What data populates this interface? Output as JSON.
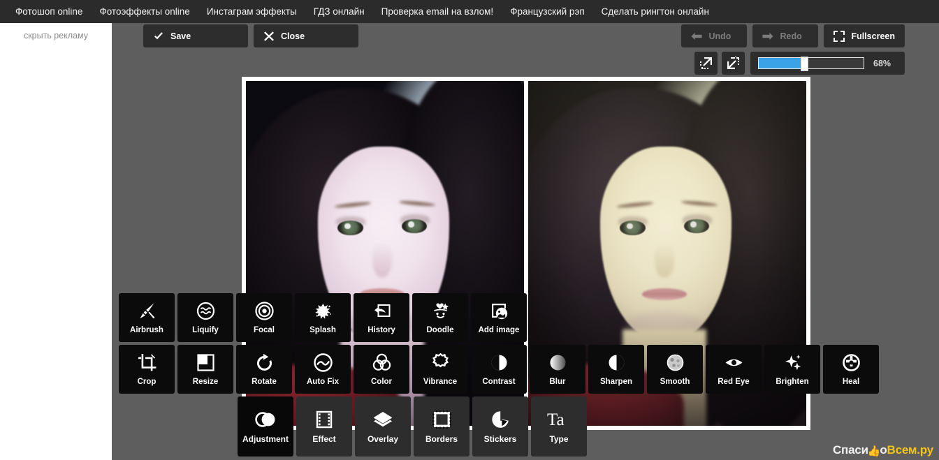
{
  "topnav": {
    "links": [
      {
        "label": "Фотошоп online"
      },
      {
        "label": "Фотоэффекты online"
      },
      {
        "label": "Инстаграм эффекты"
      },
      {
        "label": "ГДЗ онлайн"
      },
      {
        "label": "Проверка email на взлом!"
      },
      {
        "label": "Французский рэп"
      },
      {
        "label": "Сделать рингтон онлайн"
      }
    ]
  },
  "sidebar": {
    "hide_ads_label": "скрыть рекламу"
  },
  "toolbar": {
    "save_label": "Save",
    "close_label": "Close",
    "undo_label": "Undo",
    "redo_label": "Redo",
    "fullscreen_label": "Fullscreen"
  },
  "zoom": {
    "percent_label": "68%",
    "percent_value": 68,
    "fit_in_label": "zoom-out-icon",
    "fit_out_label": "zoom-in-icon",
    "fill_color": "#3aa3e8"
  },
  "tools": {
    "row_top": [
      {
        "label": "Airbrush",
        "icon": "airbrush-icon"
      },
      {
        "label": "Liquify",
        "icon": "liquify-icon"
      },
      {
        "label": "Focal",
        "icon": "focal-icon"
      },
      {
        "label": "Splash",
        "icon": "splash-icon"
      },
      {
        "label": "History",
        "icon": "history-icon"
      },
      {
        "label": "Doodle",
        "icon": "doodle-icon"
      },
      {
        "label": "Add image",
        "icon": "add-image-icon"
      }
    ],
    "row_mid": [
      {
        "label": "Crop",
        "icon": "crop-icon"
      },
      {
        "label": "Resize",
        "icon": "resize-icon"
      },
      {
        "label": "Rotate",
        "icon": "rotate-icon"
      },
      {
        "label": "Auto Fix",
        "icon": "auto-fix-icon"
      },
      {
        "label": "Color",
        "icon": "color-icon"
      },
      {
        "label": "Vibrance",
        "icon": "vibrance-icon"
      },
      {
        "label": "Contrast",
        "icon": "contrast-icon"
      },
      {
        "label": "Blur",
        "icon": "blur-icon"
      },
      {
        "label": "Sharpen",
        "icon": "sharpen-icon"
      },
      {
        "label": "Smooth",
        "icon": "smooth-icon"
      },
      {
        "label": "Red Eye",
        "icon": "red-eye-icon"
      },
      {
        "label": "Brighten",
        "icon": "brighten-icon"
      },
      {
        "label": "Heal",
        "icon": "heal-icon"
      }
    ],
    "row_bottom": [
      {
        "label": "Adjustment",
        "icon": "adjustment-icon",
        "active": true
      },
      {
        "label": "Effect",
        "icon": "effect-icon",
        "active": false
      },
      {
        "label": "Overlay",
        "icon": "overlay-icon",
        "active": false
      },
      {
        "label": "Borders",
        "icon": "borders-icon",
        "active": false
      },
      {
        "label": "Stickers",
        "icon": "stickers-icon",
        "active": false
      },
      {
        "label": "Type",
        "icon": "type-icon",
        "active": false
      }
    ]
  },
  "canvas": {
    "panels": [
      {
        "caption": "original-photo"
      },
      {
        "caption": "edited-photo"
      }
    ]
  },
  "watermark": {
    "part_a": "Спаси",
    "part_b": "о",
    "part_c": "Всем.ру"
  }
}
